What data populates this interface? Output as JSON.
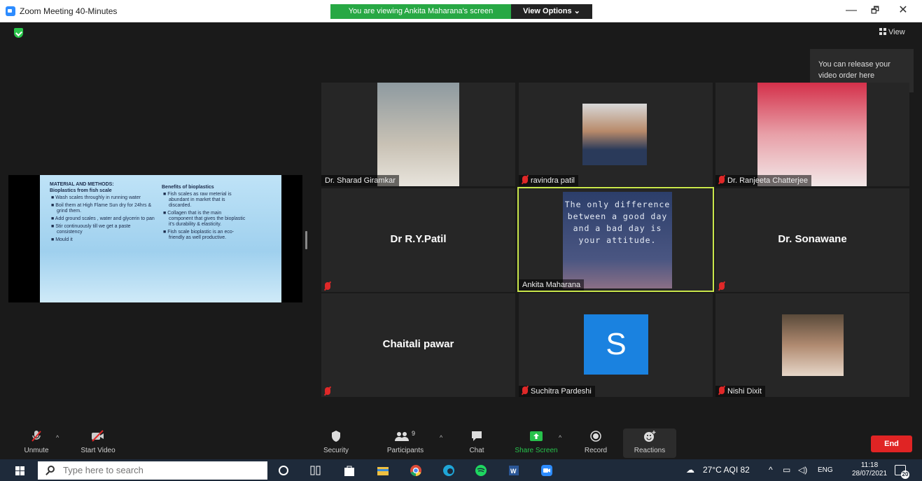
{
  "window": {
    "title": "Zoom Meeting 40-Minutes",
    "viewing_banner": "You are viewing Ankita Maharana's screen",
    "view_options": "View Options",
    "minimize": "—",
    "maximize": "🗗",
    "close": "✕"
  },
  "meeting": {
    "view_label": "View",
    "tooltip": "You can release your video order here"
  },
  "slide": {
    "col1_heading": "MATERIAL AND METHODS:",
    "col1_sub": "Bioplastics from fish scale",
    "col1_items": [
      "Wash scales throughly in running water",
      "Boil them at High Flame Sun dry for 24hrs & grind them.",
      "Add ground scales , water and glycerin to pan",
      "Stir continuously till we get a paste consistency",
      "Mould it"
    ],
    "col2_heading": "Benefits of bioplastics",
    "col2_items": [
      "Fish scales as raw meterial is abundant in market that is discarded.",
      "Collagen that is the main component that gives the bioplastic it's durability & elasticity.",
      "Fish scale bioplastic is an eco-friendly as well productive."
    ]
  },
  "participants": [
    {
      "name": "Dr. Sharad Giramkar",
      "muted": false
    },
    {
      "name": "ravindra patil",
      "muted": true
    },
    {
      "name": "Dr. Ranjeeta Chatterjee",
      "muted": true
    },
    {
      "name": "Dr R.Y.Patil",
      "muted": true
    },
    {
      "name": "Ankita Maharana",
      "muted": false,
      "active_speaker": true
    },
    {
      "name": "Dr. Sonawane",
      "muted": true
    },
    {
      "name": "Chaitali pawar",
      "muted": true
    },
    {
      "name": "Suchitra Pardeshi",
      "muted": true
    },
    {
      "name": "Nishi Dixit",
      "muted": true
    }
  ],
  "quote_text": "The only difference between a good day and a bad day is your attitude.",
  "avatar_letter": "S",
  "toolbar": {
    "unmute": "Unmute",
    "start_video": "Start Video",
    "security": "Security",
    "participants": "Participants",
    "participants_count": "9",
    "chat": "Chat",
    "share_screen": "Share Screen",
    "record": "Record",
    "reactions": "Reactions",
    "end": "End"
  },
  "taskbar": {
    "search_placeholder": "Type here to search",
    "weather": "27°C AQI 82",
    "lang": "ENG",
    "time": "11:18",
    "date": "28/07/2021",
    "notifications": "20"
  },
  "colors": {
    "banner_green": "#27a844",
    "active_speaker_border": "#c8e64a",
    "end_red": "#e02424",
    "share_green": "#27c24c"
  }
}
